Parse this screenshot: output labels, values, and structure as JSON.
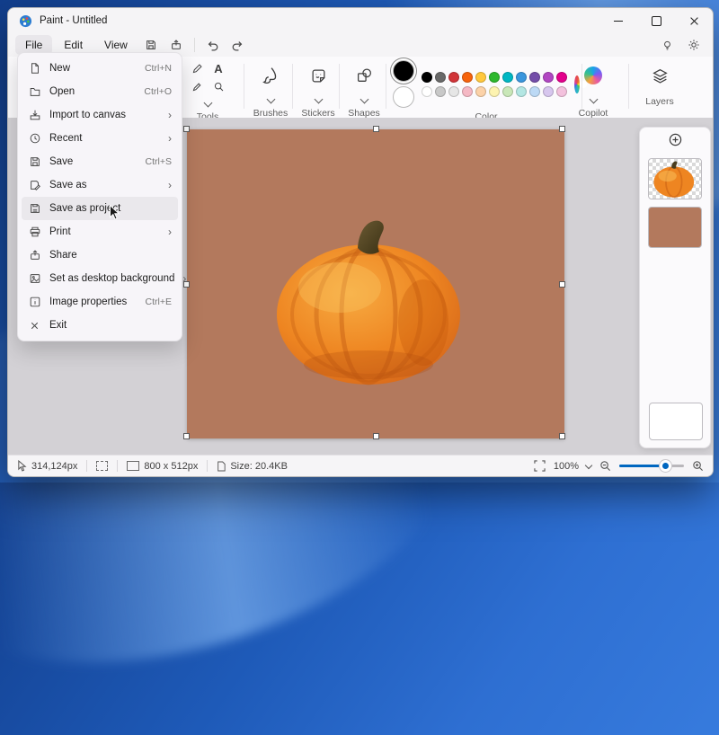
{
  "window": {
    "title": "Paint - Untitled"
  },
  "menubar": {
    "items": [
      "File",
      "Edit",
      "View"
    ]
  },
  "file_menu": {
    "items": [
      {
        "label": "New",
        "shortcut": "Ctrl+N"
      },
      {
        "label": "Open",
        "shortcut": "Ctrl+O"
      },
      {
        "label": "Import to canvas",
        "submenu": true
      },
      {
        "label": "Recent",
        "submenu": true
      },
      {
        "label": "Save",
        "shortcut": "Ctrl+S"
      },
      {
        "label": "Save as",
        "submenu": true
      },
      {
        "label": "Save as project",
        "highlighted": true
      },
      {
        "label": "Print",
        "submenu": true
      },
      {
        "label": "Share"
      },
      {
        "label": "Set as desktop background",
        "submenu": true
      },
      {
        "label": "Image properties",
        "shortcut": "Ctrl+E"
      },
      {
        "label": "Exit"
      }
    ]
  },
  "toolbar": {
    "groups": {
      "tools": "Tools",
      "brushes": "Brushes",
      "stickers": "Stickers",
      "shapes": "Shapes",
      "color": "Color",
      "copilot": "Copilot",
      "layers": "Layers"
    },
    "colors": {
      "primary": "#000000",
      "secondary": "#ffffff",
      "row1": [
        "#000000",
        "#696969",
        "#d13438",
        "#f7630c",
        "#ffc83d",
        "#2db82d",
        "#00b7c3",
        "#3a96dd",
        "#744da9",
        "#b146c2",
        "#e3008c"
      ],
      "row2": [
        "#ffffff",
        "#c8c8c8",
        "#e6e6e6",
        "#f5b8c4",
        "#fcd2a8",
        "#fdf3b0",
        "#c9e7b8",
        "#b3e6e3",
        "#bcd9f5",
        "#d7c6ee",
        "#f3c1dd"
      ]
    }
  },
  "canvas": {
    "background": "#b3795d"
  },
  "statusbar": {
    "cursor_pos": "314,124px",
    "canvas_size": "800 x 512px",
    "file_size": "Size: 20.4KB",
    "zoom": "100%"
  }
}
